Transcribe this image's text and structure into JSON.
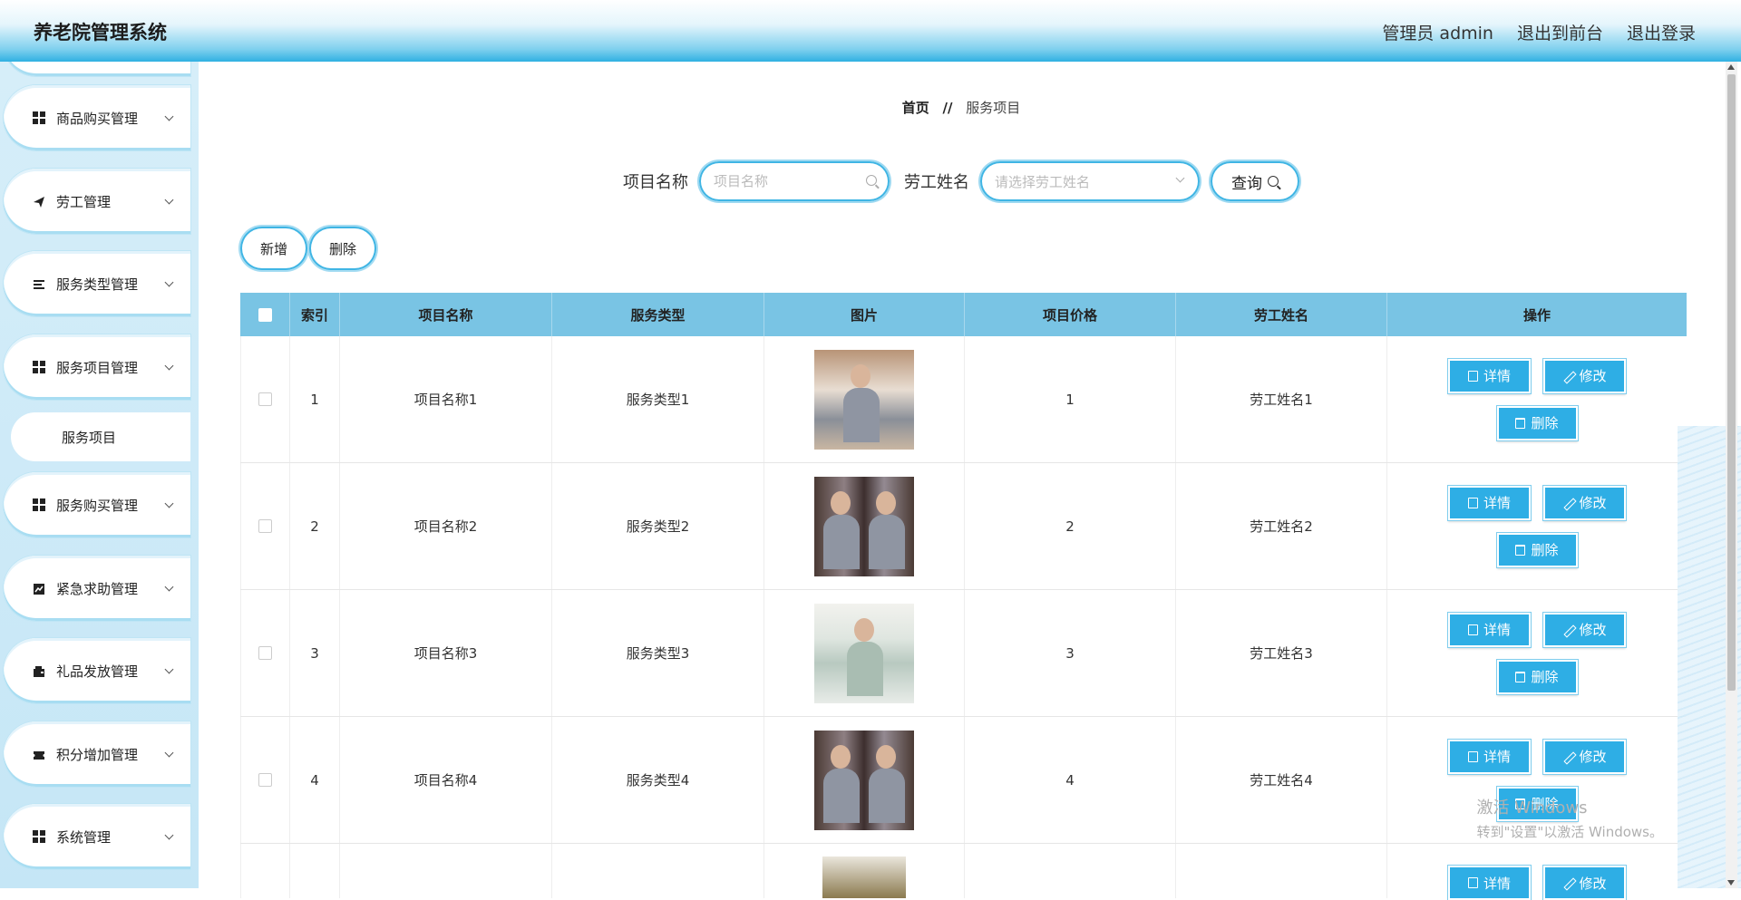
{
  "header": {
    "title": "养老院管理系统",
    "links": [
      "管理员 admin",
      "退出到前台",
      "退出登录"
    ]
  },
  "sidebar": {
    "items": [
      {
        "label": "商品购买管理",
        "icon": "grid-icon"
      },
      {
        "label": "劳工管理",
        "icon": "paper-plane-icon"
      },
      {
        "label": "服务类型管理",
        "icon": "list-icon"
      },
      {
        "label": "服务项目管理",
        "icon": "grid-icon"
      },
      {
        "label": "服务购买管理",
        "icon": "grid-icon"
      },
      {
        "label": "紧急求助管理",
        "icon": "chart-icon"
      },
      {
        "label": "礼品发放管理",
        "icon": "wallet-icon"
      },
      {
        "label": "积分增加管理",
        "icon": "ticket-icon"
      },
      {
        "label": "系统管理",
        "icon": "grid-icon"
      }
    ],
    "submenu": {
      "label": "服务项目"
    }
  },
  "breadcrumb": {
    "home": "首页",
    "separator": "//",
    "current": "服务项目"
  },
  "search": {
    "name_label": "项目名称",
    "name_placeholder": "项目名称",
    "worker_label": "劳工姓名",
    "worker_placeholder": "请选择劳工姓名",
    "query_label": "查询"
  },
  "actions": {
    "add_label": "新增",
    "delete_label": "删除"
  },
  "table": {
    "headers": [
      "索引",
      "项目名称",
      "服务类型",
      "图片",
      "项目价格",
      "劳工姓名",
      "操作"
    ],
    "rows": [
      {
        "index": "1",
        "name": "项目名称1",
        "type": "服务类型1",
        "price": "1",
        "worker": "劳工姓名1"
      },
      {
        "index": "2",
        "name": "项目名称2",
        "type": "服务类型2",
        "price": "2",
        "worker": "劳工姓名2"
      },
      {
        "index": "3",
        "name": "项目名称3",
        "type": "服务类型3",
        "price": "3",
        "worker": "劳工姓名3"
      },
      {
        "index": "4",
        "name": "项目名称4",
        "type": "服务类型4",
        "price": "4",
        "worker": "劳工姓名4"
      }
    ],
    "op_labels": {
      "detail": "详情",
      "edit": "修改",
      "delete": "删除"
    }
  },
  "watermark": {
    "title": "激活 Windows",
    "subtitle": "转到\"设置\"以激活 Windows。"
  },
  "colors": {
    "accent": "#2eaee5",
    "header_row": "#79c4e4",
    "sidebar_bg": "#d6eef9"
  }
}
